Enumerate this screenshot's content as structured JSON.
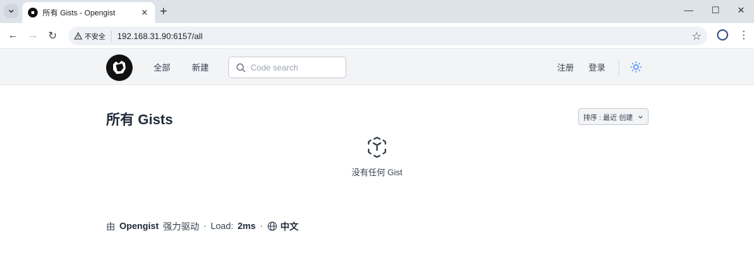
{
  "browser": {
    "tab_title": "所有 Gists - Opengist",
    "security_label": "不安全",
    "url": "192.168.31.90:6157/all"
  },
  "header": {
    "nav": [
      "全部",
      "新建"
    ],
    "search_placeholder": "Code search",
    "register": "注册",
    "login": "登录"
  },
  "main": {
    "title": "所有 Gists",
    "sort_label": "排序 : 最近 创建",
    "empty_message": "没有任何 Gist"
  },
  "footer": {
    "prefix": "由",
    "brand": "Opengist",
    "powered": "强力驱动",
    "load_label": "Load:",
    "load_value": "2ms",
    "language": "中文"
  }
}
